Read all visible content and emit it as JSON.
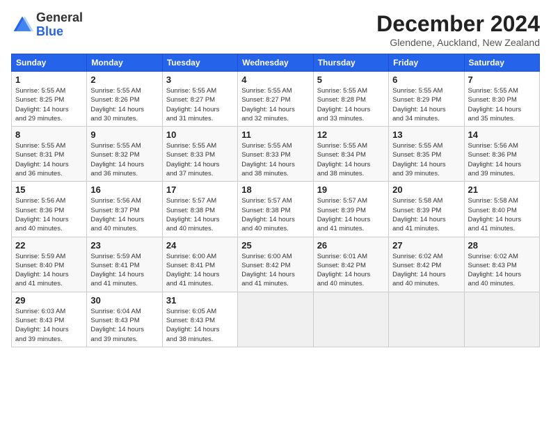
{
  "header": {
    "logo_line1": "General",
    "logo_line2": "Blue",
    "month_title": "December 2024",
    "location": "Glendene, Auckland, New Zealand"
  },
  "days_of_week": [
    "Sunday",
    "Monday",
    "Tuesday",
    "Wednesday",
    "Thursday",
    "Friday",
    "Saturday"
  ],
  "weeks": [
    [
      {
        "day": 1,
        "sunrise": "5:55 AM",
        "sunset": "8:25 PM",
        "daylight": "14 hours and 29 minutes."
      },
      {
        "day": 2,
        "sunrise": "5:55 AM",
        "sunset": "8:26 PM",
        "daylight": "14 hours and 30 minutes."
      },
      {
        "day": 3,
        "sunrise": "5:55 AM",
        "sunset": "8:27 PM",
        "daylight": "14 hours and 31 minutes."
      },
      {
        "day": 4,
        "sunrise": "5:55 AM",
        "sunset": "8:27 PM",
        "daylight": "14 hours and 32 minutes."
      },
      {
        "day": 5,
        "sunrise": "5:55 AM",
        "sunset": "8:28 PM",
        "daylight": "14 hours and 33 minutes."
      },
      {
        "day": 6,
        "sunrise": "5:55 AM",
        "sunset": "8:29 PM",
        "daylight": "14 hours and 34 minutes."
      },
      {
        "day": 7,
        "sunrise": "5:55 AM",
        "sunset": "8:30 PM",
        "daylight": "14 hours and 35 minutes."
      }
    ],
    [
      {
        "day": 8,
        "sunrise": "5:55 AM",
        "sunset": "8:31 PM",
        "daylight": "14 hours and 36 minutes."
      },
      {
        "day": 9,
        "sunrise": "5:55 AM",
        "sunset": "8:32 PM",
        "daylight": "14 hours and 36 minutes."
      },
      {
        "day": 10,
        "sunrise": "5:55 AM",
        "sunset": "8:33 PM",
        "daylight": "14 hours and 37 minutes."
      },
      {
        "day": 11,
        "sunrise": "5:55 AM",
        "sunset": "8:33 PM",
        "daylight": "14 hours and 38 minutes."
      },
      {
        "day": 12,
        "sunrise": "5:55 AM",
        "sunset": "8:34 PM",
        "daylight": "14 hours and 38 minutes."
      },
      {
        "day": 13,
        "sunrise": "5:55 AM",
        "sunset": "8:35 PM",
        "daylight": "14 hours and 39 minutes."
      },
      {
        "day": 14,
        "sunrise": "5:56 AM",
        "sunset": "8:36 PM",
        "daylight": "14 hours and 39 minutes."
      }
    ],
    [
      {
        "day": 15,
        "sunrise": "5:56 AM",
        "sunset": "8:36 PM",
        "daylight": "14 hours and 40 minutes."
      },
      {
        "day": 16,
        "sunrise": "5:56 AM",
        "sunset": "8:37 PM",
        "daylight": "14 hours and 40 minutes."
      },
      {
        "day": 17,
        "sunrise": "5:57 AM",
        "sunset": "8:38 PM",
        "daylight": "14 hours and 40 minutes."
      },
      {
        "day": 18,
        "sunrise": "5:57 AM",
        "sunset": "8:38 PM",
        "daylight": "14 hours and 40 minutes."
      },
      {
        "day": 19,
        "sunrise": "5:57 AM",
        "sunset": "8:39 PM",
        "daylight": "14 hours and 41 minutes."
      },
      {
        "day": 20,
        "sunrise": "5:58 AM",
        "sunset": "8:39 PM",
        "daylight": "14 hours and 41 minutes."
      },
      {
        "day": 21,
        "sunrise": "5:58 AM",
        "sunset": "8:40 PM",
        "daylight": "14 hours and 41 minutes."
      }
    ],
    [
      {
        "day": 22,
        "sunrise": "5:59 AM",
        "sunset": "8:40 PM",
        "daylight": "14 hours and 41 minutes."
      },
      {
        "day": 23,
        "sunrise": "5:59 AM",
        "sunset": "8:41 PM",
        "daylight": "14 hours and 41 minutes."
      },
      {
        "day": 24,
        "sunrise": "6:00 AM",
        "sunset": "8:41 PM",
        "daylight": "14 hours and 41 minutes."
      },
      {
        "day": 25,
        "sunrise": "6:00 AM",
        "sunset": "8:42 PM",
        "daylight": "14 hours and 41 minutes."
      },
      {
        "day": 26,
        "sunrise": "6:01 AM",
        "sunset": "8:42 PM",
        "daylight": "14 hours and 40 minutes."
      },
      {
        "day": 27,
        "sunrise": "6:02 AM",
        "sunset": "8:42 PM",
        "daylight": "14 hours and 40 minutes."
      },
      {
        "day": 28,
        "sunrise": "6:02 AM",
        "sunset": "8:43 PM",
        "daylight": "14 hours and 40 minutes."
      }
    ],
    [
      {
        "day": 29,
        "sunrise": "6:03 AM",
        "sunset": "8:43 PM",
        "daylight": "14 hours and 39 minutes."
      },
      {
        "day": 30,
        "sunrise": "6:04 AM",
        "sunset": "8:43 PM",
        "daylight": "14 hours and 39 minutes."
      },
      {
        "day": 31,
        "sunrise": "6:05 AM",
        "sunset": "8:43 PM",
        "daylight": "14 hours and 38 minutes."
      },
      null,
      null,
      null,
      null
    ]
  ]
}
